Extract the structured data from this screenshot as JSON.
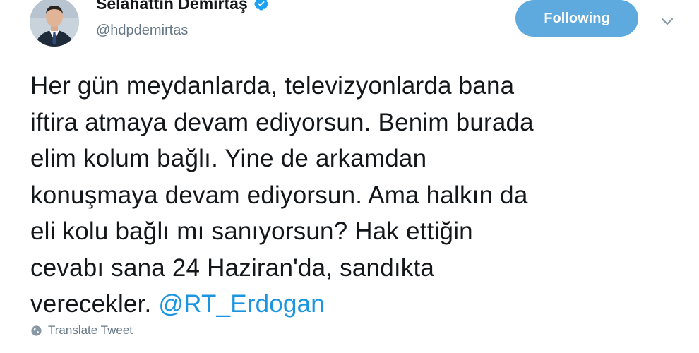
{
  "author": {
    "display_name": "Selahattin Demirtaş",
    "handle": "@hdpdemirtas",
    "verified": true
  },
  "actions": {
    "follow_label": "Following",
    "caret_icon": "chevron-down-icon"
  },
  "tweet": {
    "lines": [
      "Her gün meydanlarda, televizyonlarda bana",
      "iftira atmaya devam ediyorsun. Benim burada",
      "elim kolum bağlı. Yine de arkamdan",
      "konuşmaya devam ediyorsun. Ama halkın da",
      "eli kolu bağlı mı sanıyorsun? Hak ettiğin",
      "cevabı sana 24 Haziran'da, sandıkta"
    ],
    "last_line_text": "verecekler. ",
    "mention": "@RT_Erdogan"
  },
  "translate": {
    "label": "Translate Tweet",
    "icon": "globe-icon"
  },
  "colors": {
    "follow_button_bg": "#5ea9dd",
    "link": "#1b95e0",
    "secondary_text": "#657786",
    "verified": "#1da1f2"
  }
}
